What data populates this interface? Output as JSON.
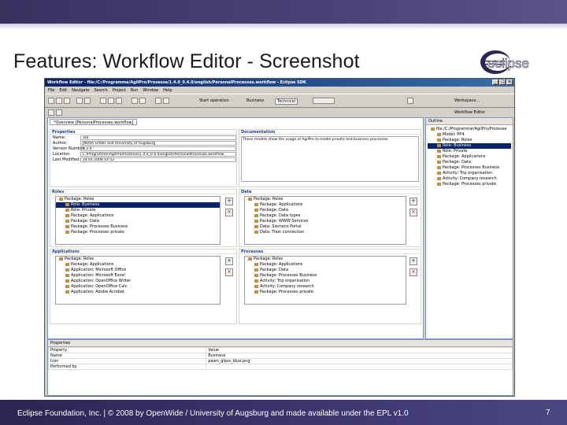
{
  "slide": {
    "title": "Features: Workflow Editor - Screenshot",
    "footer": "Eclipse Foundation, Inc. | © 2008 by OpenWide / University of Augsburg and made available under the EPL v1.0",
    "page_number": "7",
    "logo_text": "eclipse",
    "colors": {
      "band": "#3e3770",
      "logo": "#2c2552"
    }
  },
  "ide": {
    "window_title": "Workflow Editor - file:/C:/Programme/AgilPro/Prozesse/1.4.0_0.4.0/english/PersonalProcesses.workflow - Eclipse SDK",
    "menus": [
      "File",
      "Edit",
      "Navigate",
      "Search",
      "Project",
      "Run",
      "Window",
      "Help"
    ],
    "toolbar": {
      "startup": "Start operation",
      "business": "Business",
      "technical": "Technical",
      "perspective": "Workflow Editor",
      "workspace": "Workspace..."
    },
    "editor_tab": "*Overview [PersonalProcesses.workflow]",
    "properties": {
      "header": "Properties",
      "fields": [
        {
          "label": "Name:",
          "value": "Tea"
        },
        {
          "label": "Author:",
          "value": "JNOVA GmbH and University of Augsburg"
        },
        {
          "label": "Version Number:",
          "value": "1.3.0"
        },
        {
          "label": "Location:",
          "value": "C:\\Programme\\AgilPro\\Prozesse\\1.4.0_0.4.0\\english\\PersonalProcesses.workflow"
        },
        {
          "label": "Last Modified:",
          "value": "24.01.2008 14:52"
        }
      ]
    },
    "documentation": {
      "header": "Documentation",
      "text": "These models show the usage of AgilPro to model private and business processes."
    },
    "roles": {
      "header": "Roles",
      "items": [
        {
          "t": "Package: Roles",
          "s": false
        },
        {
          "t": "Role: Business",
          "s": true
        },
        {
          "t": "Role: Private",
          "s": false
        },
        {
          "t": "Package: Applications",
          "s": false
        },
        {
          "t": "Package: Data",
          "s": false
        },
        {
          "t": "Package: Processes Business",
          "s": false
        },
        {
          "t": "Package: Processes private",
          "s": false
        }
      ]
    },
    "data": {
      "header": "Data",
      "items": [
        "Package: Roles",
        "Package: Applications",
        "Package: Data",
        "Package: Data types",
        "Package: WWW Services",
        "Data: Siemens Portal",
        "Data: Train connection"
      ]
    },
    "applications": {
      "header": "Applications",
      "items": [
        "Package: Roles",
        "Package: Applications",
        "Application: Microsoft Office",
        "Application: Microsoft Excel",
        "Application: OpenOffice Writer",
        "Application: OpenOffice Calc",
        "Application: Adobe Acrobat"
      ]
    },
    "processes": {
      "header": "Processes",
      "items": [
        "Package: Roles",
        "Package: Applications",
        "Package: Data",
        "Package: Processes Business",
        "Activity: Trip organisation",
        "Activity: Company research",
        "Package: Processes private"
      ]
    },
    "editor_bottom_tabs": [
      "Overview",
      "Trip organisation"
    ],
    "outline": {
      "tab": "Outline",
      "items": [
        {
          "t": "file:/C:/Programme/AgilPro/Prozesse",
          "s": false
        },
        {
          "t": "Model: PP4",
          "s": false
        },
        {
          "t": "Package: Roles",
          "s": false
        },
        {
          "t": "Role: Business",
          "s": true
        },
        {
          "t": "Role: Private",
          "s": false
        },
        {
          "t": "Package: Applications",
          "s": false
        },
        {
          "t": "Package: Data",
          "s": false
        },
        {
          "t": "Package: Processes Business",
          "s": false
        },
        {
          "t": "Activity: Trip organisation",
          "s": false
        },
        {
          "t": "Activity: Company research",
          "s": false
        },
        {
          "t": "Package: Processes private",
          "s": false
        }
      ]
    },
    "props_view": {
      "tab": "Properties",
      "col_property": "Property",
      "col_value": "Value",
      "rows": [
        {
          "p": "Name",
          "v": "Business"
        },
        {
          "p": "Icon",
          "v": "pawn_glass_blue.png"
        },
        {
          "p": "Performed by",
          "v": ""
        }
      ]
    }
  }
}
